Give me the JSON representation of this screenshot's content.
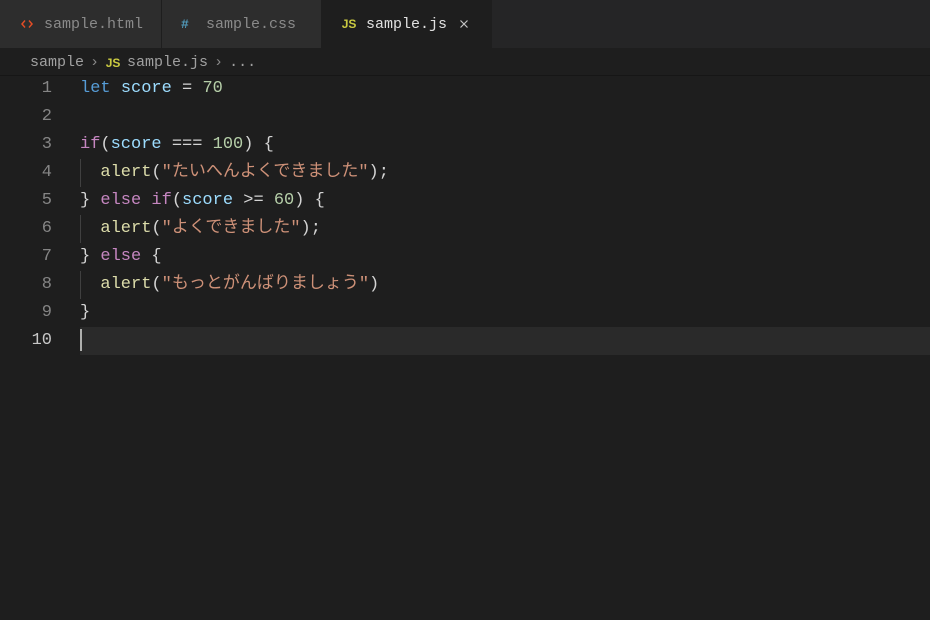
{
  "tabs": [
    {
      "label": "sample.html",
      "icon": "html"
    },
    {
      "label": "sample.css",
      "icon": "css"
    },
    {
      "label": "sample.js",
      "icon": "js",
      "active": true
    }
  ],
  "breadcrumb": {
    "folder": "sample",
    "file": "sample.js",
    "symbol": "..."
  },
  "code": {
    "lines": [
      [
        {
          "t": "let ",
          "c": "kw"
        },
        {
          "t": "score",
          "c": "var"
        },
        {
          "t": " ",
          "c": "op"
        },
        {
          "t": "=",
          "c": "op"
        },
        {
          "t": " ",
          "c": "op"
        },
        {
          "t": "70",
          "c": "num"
        }
      ],
      [],
      [
        {
          "t": "if",
          "c": "ctrl"
        },
        {
          "t": "(",
          "c": "pun"
        },
        {
          "t": "score",
          "c": "var"
        },
        {
          "t": " ",
          "c": "op"
        },
        {
          "t": "===",
          "c": "op"
        },
        {
          "t": " ",
          "c": "op"
        },
        {
          "t": "100",
          "c": "num"
        },
        {
          "t": ")",
          "c": "pun"
        },
        {
          "t": " ",
          "c": "op"
        },
        {
          "t": "{",
          "c": "pun"
        }
      ],
      [
        {
          "t": "  ",
          "c": "op",
          "g": 1
        },
        {
          "t": "alert",
          "c": "fn"
        },
        {
          "t": "(",
          "c": "pun"
        },
        {
          "t": "\"たいへんよくできました\"",
          "c": "str"
        },
        {
          "t": ")",
          "c": "pun"
        },
        {
          "t": ";",
          "c": "pun"
        }
      ],
      [
        {
          "t": "}",
          "c": "pun"
        },
        {
          "t": " ",
          "c": "op"
        },
        {
          "t": "else if",
          "c": "ctrl"
        },
        {
          "t": "(",
          "c": "pun"
        },
        {
          "t": "score",
          "c": "var"
        },
        {
          "t": " ",
          "c": "op"
        },
        {
          "t": ">=",
          "c": "op"
        },
        {
          "t": " ",
          "c": "op"
        },
        {
          "t": "60",
          "c": "num"
        },
        {
          "t": ")",
          "c": "pun"
        },
        {
          "t": " ",
          "c": "op"
        },
        {
          "t": "{",
          "c": "pun"
        }
      ],
      [
        {
          "t": "  ",
          "c": "op",
          "g": 1
        },
        {
          "t": "alert",
          "c": "fn"
        },
        {
          "t": "(",
          "c": "pun"
        },
        {
          "t": "\"よくできました\"",
          "c": "str"
        },
        {
          "t": ")",
          "c": "pun"
        },
        {
          "t": ";",
          "c": "pun"
        }
      ],
      [
        {
          "t": "}",
          "c": "pun"
        },
        {
          "t": " ",
          "c": "op"
        },
        {
          "t": "else",
          "c": "ctrl"
        },
        {
          "t": " ",
          "c": "op"
        },
        {
          "t": "{",
          "c": "pun"
        }
      ],
      [
        {
          "t": "  ",
          "c": "op",
          "g": 1
        },
        {
          "t": "alert",
          "c": "fn"
        },
        {
          "t": "(",
          "c": "pun"
        },
        {
          "t": "\"もっとがんばりましょう\"",
          "c": "str"
        },
        {
          "t": ")",
          "c": "pun"
        }
      ],
      [
        {
          "t": "}",
          "c": "pun"
        }
      ],
      []
    ],
    "currentLine": 10
  }
}
